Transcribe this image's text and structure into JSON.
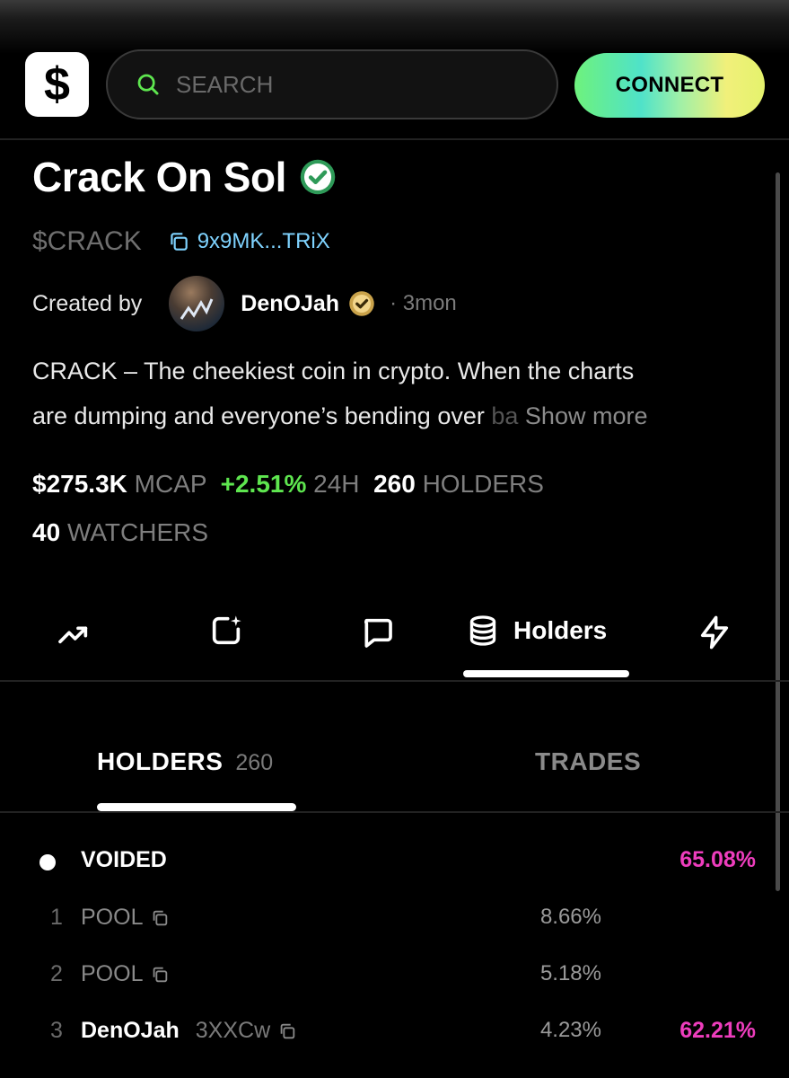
{
  "header": {
    "logo_symbol": "$",
    "search_placeholder": "SEARCH",
    "connect_label": "CONNECT"
  },
  "token": {
    "name": "Crack On Sol",
    "ticker": "$CRACK",
    "address": "9x9MK...TRiX",
    "created_by_label": "Created by",
    "creator_name": "DenOJah",
    "age": "· 3mon",
    "description_line1": "CRACK – The cheekiest coin in crypto.  When the charts",
    "description_line2": "are dumping and everyone’s bending over ",
    "description_fade": "ba",
    "show_more_label": "Show more"
  },
  "stats": {
    "mcap_value": "$275.3K",
    "mcap_label": "MCAP",
    "change_value": "+2.51%",
    "change_label": "24H",
    "holders_value": "260",
    "holders_label": "HOLDERS",
    "watchers_value": "40",
    "watchers_label": "WATCHERS"
  },
  "tabs": {
    "icons": [
      "trending-icon",
      "sparkle-square-icon",
      "chat-icon",
      "coins-stack-icon",
      "lightning-icon"
    ],
    "active_label": "Holders"
  },
  "subtabs": {
    "holders_label": "HOLDERS",
    "holders_count": "260",
    "trades_label": "TRADES"
  },
  "holders": {
    "voided": {
      "label": "VOIDED",
      "total": "65.08%"
    },
    "rows": [
      {
        "rank": "1",
        "name": "POOL",
        "address": "",
        "pct": "8.66%",
        "total": ""
      },
      {
        "rank": "2",
        "name": "POOL",
        "address": "",
        "pct": "5.18%",
        "total": ""
      },
      {
        "rank": "3",
        "name": "DenOJah",
        "address": "3XXCw",
        "pct": "4.23%",
        "total": "62.21%"
      }
    ]
  },
  "colors": {
    "accent_green": "#5ee64f",
    "accent_pink": "#ee3dbd",
    "address_blue": "#7fd3ff",
    "background": "#000000"
  }
}
